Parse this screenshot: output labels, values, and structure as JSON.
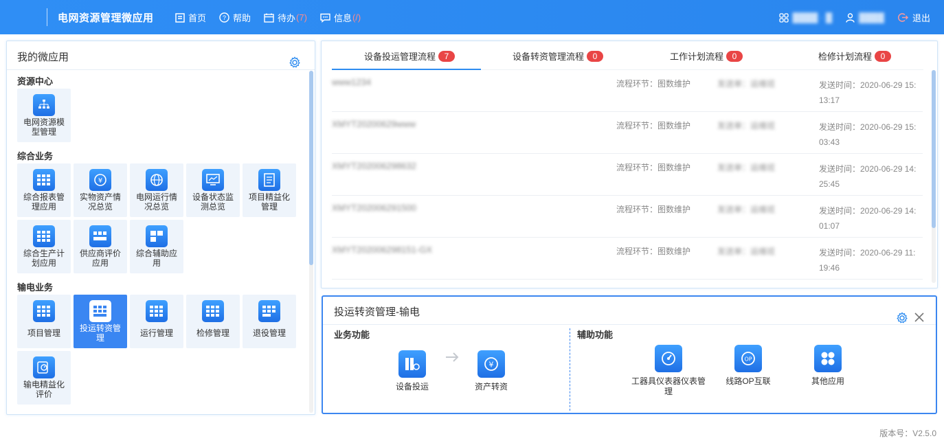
{
  "header": {
    "title": "电网资源管理微应用",
    "nav": [
      {
        "label": "首页",
        "count": ""
      },
      {
        "label": "帮助",
        "count": ""
      },
      {
        "label": "待办",
        "count": "(7)"
      },
      {
        "label": "信息",
        "count": "(/)"
      }
    ],
    "org": "████ · █",
    "user": "████",
    "logout": "退出"
  },
  "left_panel": {
    "title": "我的微应用",
    "sections": [
      {
        "title": "资源中心",
        "tiles": [
          {
            "label": "电网资源模型管理",
            "icon": "hierarchy-icon"
          }
        ]
      },
      {
        "title": "综合业务",
        "tiles": [
          {
            "label": "综合报表管理应用",
            "icon": "grid-icon"
          },
          {
            "label": "实物资产情况总览",
            "icon": "yen-clock-icon"
          },
          {
            "label": "电网运行情况总览",
            "icon": "globe-icon"
          },
          {
            "label": "设备状态监测总览",
            "icon": "monitor-icon"
          },
          {
            "label": "项目精益化管理",
            "icon": "document-icon"
          },
          {
            "label": "综合生产计划应用",
            "icon": "grid-icon"
          },
          {
            "label": "供应商评价应用",
            "icon": "grid-icon"
          },
          {
            "label": "综合辅助应用",
            "icon": "grid-icon"
          }
        ]
      },
      {
        "title": "输电业务",
        "tiles": [
          {
            "label": "项目管理",
            "icon": "grid-icon"
          },
          {
            "label": "投运转资管理",
            "icon": "grid-icon",
            "active": true
          },
          {
            "label": "运行管理",
            "icon": "grid-icon"
          },
          {
            "label": "检修管理",
            "icon": "grid-icon"
          },
          {
            "label": "退役管理",
            "icon": "grid-icon"
          },
          {
            "label": "输电精益化评价",
            "icon": "gauge-icon"
          }
        ]
      }
    ]
  },
  "flow_panel": {
    "tabs": [
      {
        "label": "设备投运管理流程",
        "count": "7"
      },
      {
        "label": "设备转资管理流程",
        "count": "0"
      },
      {
        "label": "工作计划流程",
        "count": "0"
      },
      {
        "label": "检修计划流程",
        "count": "0"
      }
    ],
    "rows": [
      {
        "id": "www1234",
        "stage": "流程环节：图数维护",
        "sender": "发送单：运维班",
        "time1": "发送时间：2020-06-29 15:",
        "time2": "13:17"
      },
      {
        "id": "XMYT202006​29www",
        "stage": "流程环节：图数维护",
        "sender": "发送单：运维班",
        "time1": "发送时间：2020-06-29 15:",
        "time2": "03:43"
      },
      {
        "id": "XMYT202006298632",
        "stage": "流程环节：图数维护",
        "sender": "发送单：运维班",
        "time1": "发送时间：2020-06-29 14:",
        "time2": "25:45"
      },
      {
        "id": "XMYT20200629​1500",
        "stage": "流程环节：图数维护",
        "sender": "发送单：运维班",
        "time1": "发送时间：2020-06-29 14:",
        "time2": "01:07"
      },
      {
        "id": "XMYT202006298151-GX",
        "stage": "流程环节：图数维护",
        "sender": "发送单：运维班",
        "time1": "发送时间：2020-06-29 11:",
        "time2": "19:46"
      }
    ]
  },
  "detail_panel": {
    "title": "投运转资管理-输电",
    "business_title": "业务功能",
    "assist_title": "辅助功能",
    "business": [
      {
        "label": "设备投运",
        "icon": "equipment-icon"
      },
      {
        "label": "资产转资",
        "icon": "yen-cycle-icon"
      }
    ],
    "assist": [
      {
        "label": "工器具仪表器仪表管理",
        "icon": "gauge-icon"
      },
      {
        "label": "线路OP互联",
        "icon": "op-icon"
      },
      {
        "label": "其他应用",
        "icon": "apps-icon"
      }
    ]
  },
  "footer": {
    "version": "版本号：V2.5.0"
  },
  "colors": {
    "primary": "#2d8cf0",
    "badge": "#e94545",
    "tile_bg": "#eef4fb",
    "tile_active": "#3a86f2"
  }
}
